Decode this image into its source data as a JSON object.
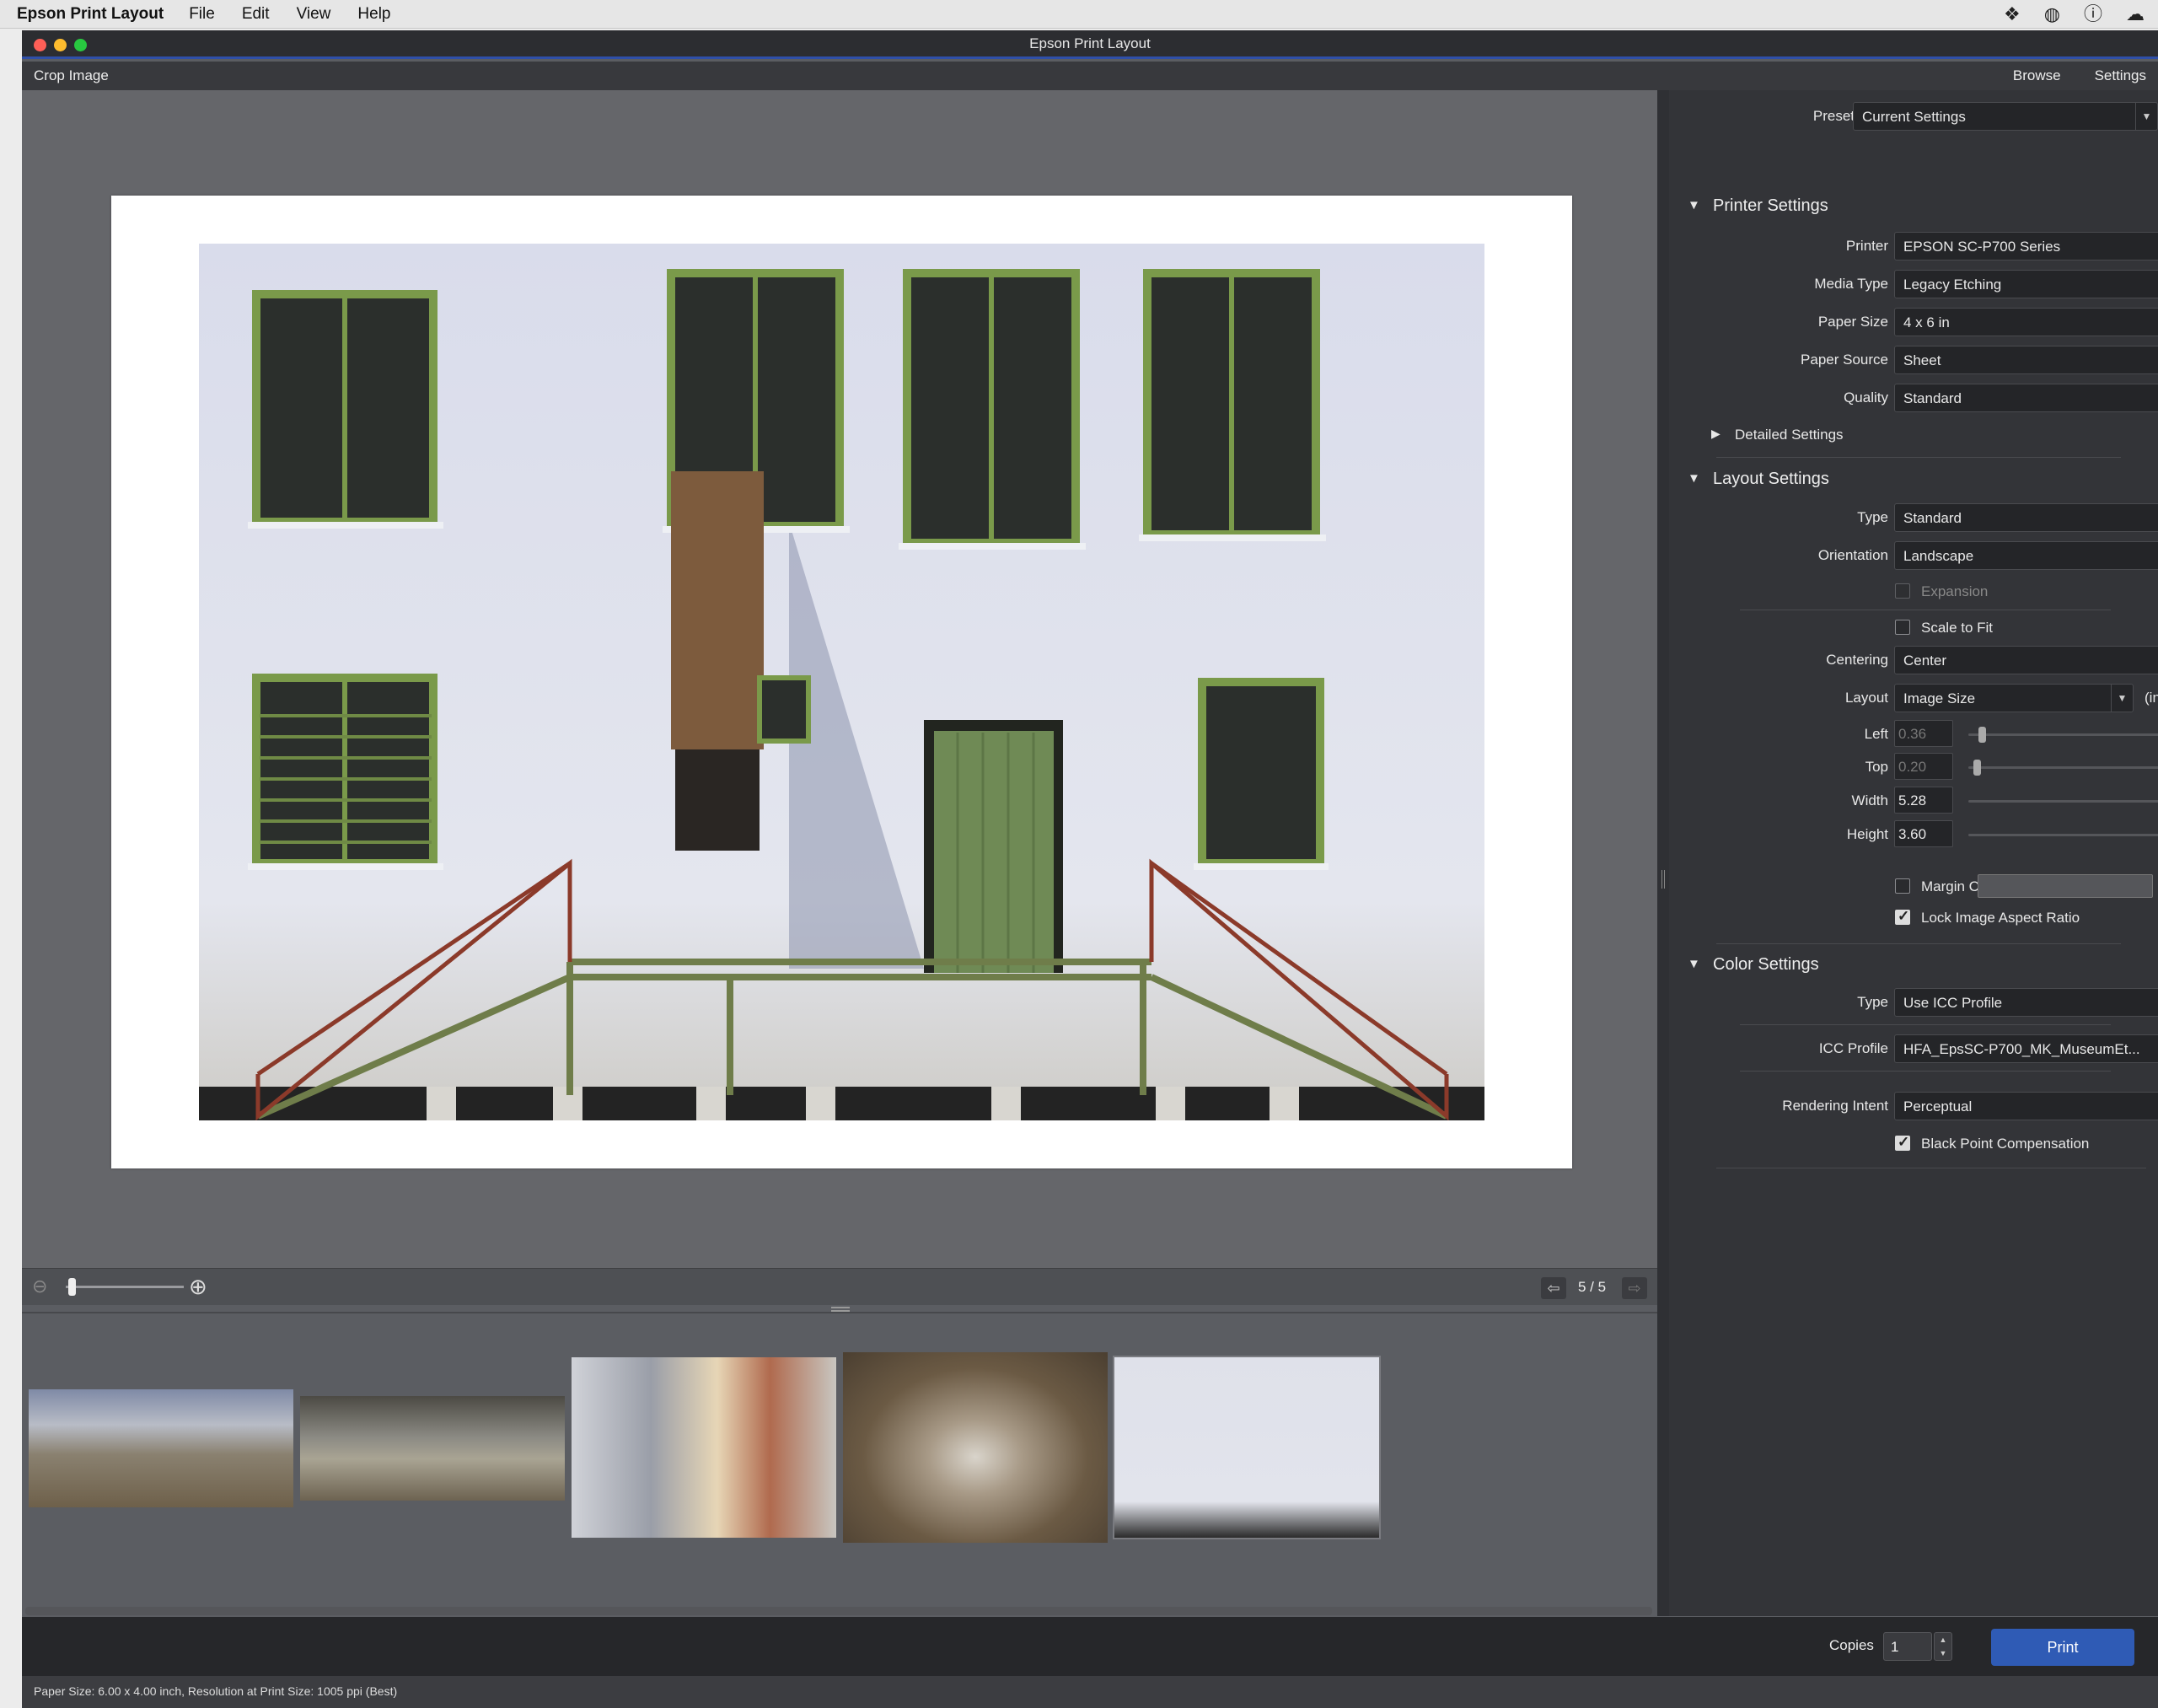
{
  "menubar": {
    "app_name": "Epson Print Layout",
    "menus": [
      "File",
      "Edit",
      "View",
      "Help"
    ],
    "status_icons": [
      "dropbox-icon",
      "globe-icon",
      "info-circle-icon",
      "creative-cloud-icon"
    ]
  },
  "window": {
    "title": "Epson Print Layout"
  },
  "toolbar": {
    "crop_label": "Crop Image",
    "browse_label": "Browse",
    "settings_label": "Settings"
  },
  "preview": {
    "zoom_level": 0.02,
    "page_indicator": "5 / 5"
  },
  "filmstrip": {
    "thumbnails": [
      "mountain-landscape",
      "mining-town-buildings",
      "colorful-buildings",
      "arctic-fox",
      "white-building-green-windows"
    ],
    "selected_index": 4
  },
  "panel": {
    "preset_label": "Preset",
    "preset_value": "Current Settings",
    "printer_settings": {
      "title": "Printer Settings",
      "printer_label": "Printer",
      "printer_value": "EPSON SC-P700 Series",
      "media_type_label": "Media Type",
      "media_type_value": "Legacy Etching",
      "paper_size_label": "Paper Size",
      "paper_size_value": "4 x 6 in",
      "paper_source_label": "Paper Source",
      "paper_source_value": "Sheet",
      "quality_label": "Quality",
      "quality_value": "Standard",
      "detailed_label": "Detailed Settings"
    },
    "layout_settings": {
      "title": "Layout Settings",
      "type_label": "Type",
      "type_value": "Standard",
      "orientation_label": "Orientation",
      "orientation_value": "Landscape",
      "expansion_label": "Expansion",
      "scale_label": "Scale to Fit",
      "centering_label": "Centering",
      "centering_value": "Center",
      "layout_label": "Layout",
      "layout_value": "Image Size",
      "unit_label": "(inch)",
      "left_label": "Left",
      "left_value": "0.36",
      "top_label": "Top",
      "top_value": "0.20",
      "width_label": "Width",
      "width_value": "5.28",
      "height_label": "Height",
      "height_value": "3.60",
      "margin_color_label": "Margin Color",
      "lock_aspect_label": "Lock Image Aspect Ratio"
    },
    "color_settings": {
      "title": "Color Settings",
      "type_label": "Type",
      "type_value": "Use ICC Profile",
      "icc_label": "ICC Profile",
      "icc_value": "HFA_EpsSC-P700_MK_MuseumEt...",
      "intent_label": "Rendering Intent",
      "intent_value": "Perceptual",
      "bpc_label": "Black Point Compensation"
    }
  },
  "bottom": {
    "copies_label": "Copies",
    "copies_value": "1",
    "print_label": "Print"
  },
  "statusbar": {
    "text": "Paper Size: 6.00 x 4.00 inch,   Resolution at Print Size: 1005 ppi (Best)"
  },
  "colors": {
    "accent": "#2f5bb5",
    "panel_bg": "#333438",
    "preview_bg": "#65666a"
  }
}
